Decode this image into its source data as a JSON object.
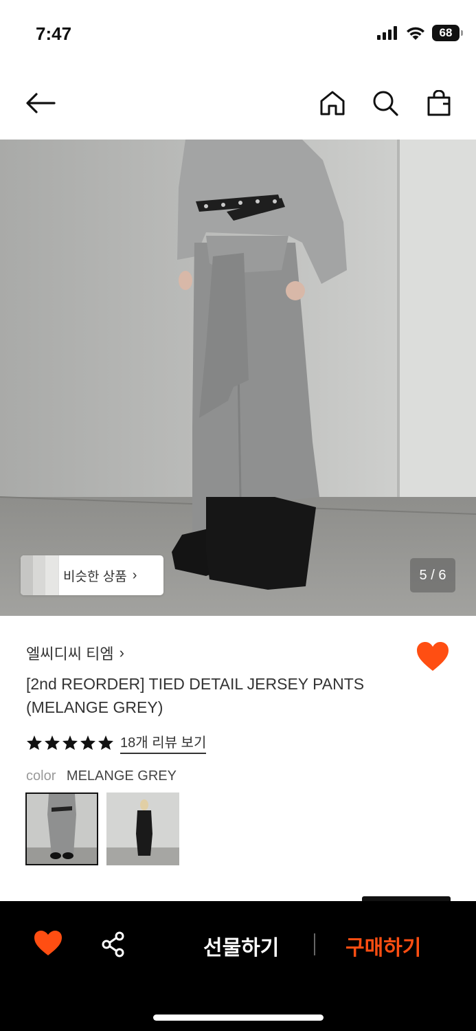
{
  "status_bar": {
    "time": "7:47",
    "battery": "68",
    "icons": [
      "signal-icon",
      "wifi-icon",
      "battery-icon"
    ]
  },
  "nav": {
    "icons": [
      "back-arrow-icon",
      "home-icon",
      "search-icon",
      "shopping-bag-icon"
    ]
  },
  "hero": {
    "similar_label": "비슷한 상품",
    "page_counter": "5 / 6"
  },
  "product": {
    "brand": "엘씨디씨 티엠",
    "title": "[2nd REORDER] TIED DETAIL JERSEY PANTS (MELANGE GREY)",
    "rating_stars": 5,
    "review_link": "18개 리뷰 보기",
    "color_key": "color",
    "color_value": "MELANGE GREY",
    "wishlisted": true
  },
  "bottom_bar": {
    "gift_label": "선물하기",
    "buy_label": "구매하기",
    "icons": [
      "heart-icon",
      "share-icon"
    ]
  },
  "colors": {
    "accent": "#ff4e12",
    "bottom_bar_bg": "#000000"
  }
}
